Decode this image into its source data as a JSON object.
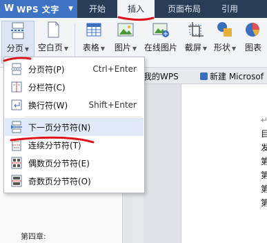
{
  "app": {
    "name": "WPS 文字"
  },
  "menu_tabs": [
    "开始",
    "插入",
    "页面布局",
    "引用"
  ],
  "active_tab": "插入",
  "ribbon": {
    "page_break": "分页",
    "blank_page": "空白页",
    "table": "表格",
    "picture": "图片",
    "online_picture": "在线图片",
    "screenshot": "截屏",
    "shape": "形状",
    "chart": "图表"
  },
  "doc_tabs": [
    "我的WPS",
    "新建 Microsof"
  ],
  "page_text": [
    "↵",
    "目",
    "发",
    "第",
    "第",
    "第",
    "第"
  ],
  "nav": {
    "item": "第四章:"
  },
  "dropdown": {
    "items": [
      {
        "label": "分页符(P)",
        "shortcut": "Ctrl+Enter",
        "icon": "page-break-icon"
      },
      {
        "label": "分栏符(C)",
        "shortcut": "",
        "icon": "column-break-icon"
      },
      {
        "label": "换行符(W)",
        "shortcut": "Shift+Enter",
        "icon": "line-break-icon"
      },
      {
        "label": "下一页分节符(N)",
        "shortcut": "",
        "icon": "next-page-section-icon"
      },
      {
        "label": "连续分节符(T)",
        "shortcut": "",
        "icon": "continuous-section-icon"
      },
      {
        "label": "偶数页分节符(E)",
        "shortcut": "",
        "icon": "even-page-section-icon"
      },
      {
        "label": "奇数页分节符(O)",
        "shortcut": "",
        "icon": "odd-page-section-icon"
      }
    ],
    "highlighted_index": 3
  },
  "colors": {
    "title_bar": "#2a3c56",
    "app_button": "#3f74c4",
    "annotation": "#e0101a",
    "highlight": "#dfe9f7"
  }
}
